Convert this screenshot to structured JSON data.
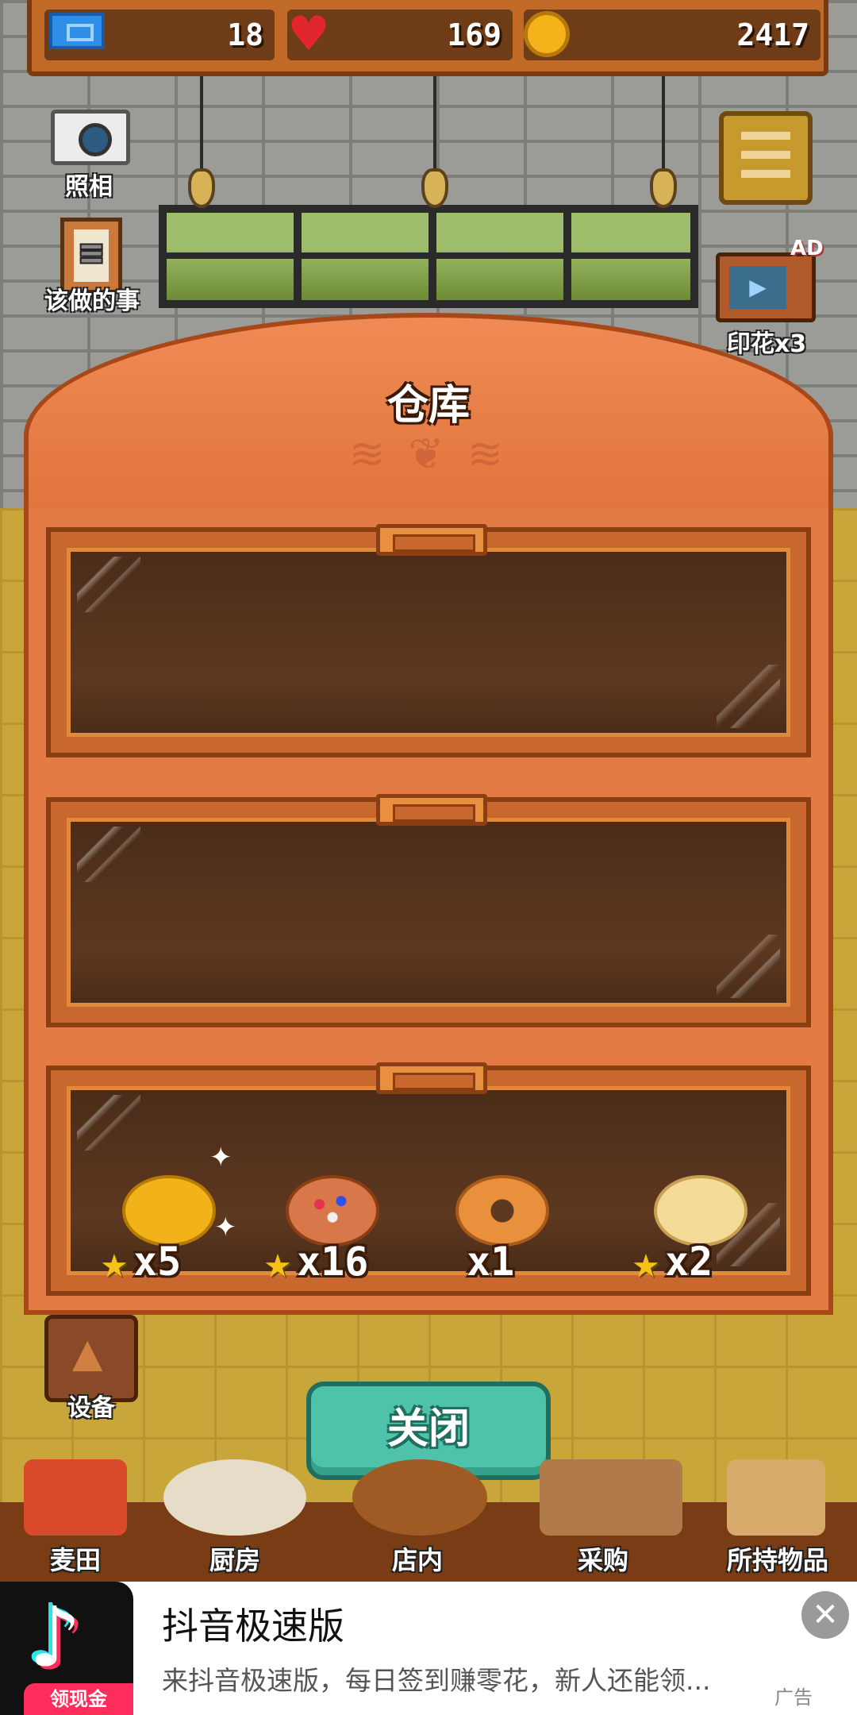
{
  "hud": {
    "tickets": "18",
    "hearts": "169",
    "coins": "2417",
    "ticket_icon": "ticket-icon",
    "heart_icon": "heart-icon",
    "coin_icon": "coin-icon"
  },
  "side_buttons": {
    "camera_label": "照相",
    "todo_label": "该做的事",
    "stamp_label": "印花x3",
    "ad_tag": "AD",
    "equipment_label": "设备"
  },
  "storage": {
    "title": "仓库",
    "items": [
      {
        "name": "pumpkin-bread",
        "starred": true,
        "count": "x5",
        "color": "#f2b21a"
      },
      {
        "name": "sprinkle-pie",
        "starred": true,
        "count": "x16",
        "color": "#d8784a"
      },
      {
        "name": "bagel",
        "starred": false,
        "count": "x1",
        "color": "#e8903c"
      },
      {
        "name": "cream-bun",
        "starred": true,
        "count": "x2",
        "color": "#f4dc98"
      }
    ]
  },
  "close_label": "关闭",
  "nav": {
    "items": [
      "麦田",
      "厨房",
      "店内",
      "采购",
      "所持物品"
    ]
  },
  "ad": {
    "app_name": "抖音极速版",
    "description": "来抖音极速版，每日签到赚零花，新人还能领...",
    "cash_badge": "领现金",
    "label": "广告",
    "close_glyph": "✕",
    "logo_glyph": "♪"
  }
}
